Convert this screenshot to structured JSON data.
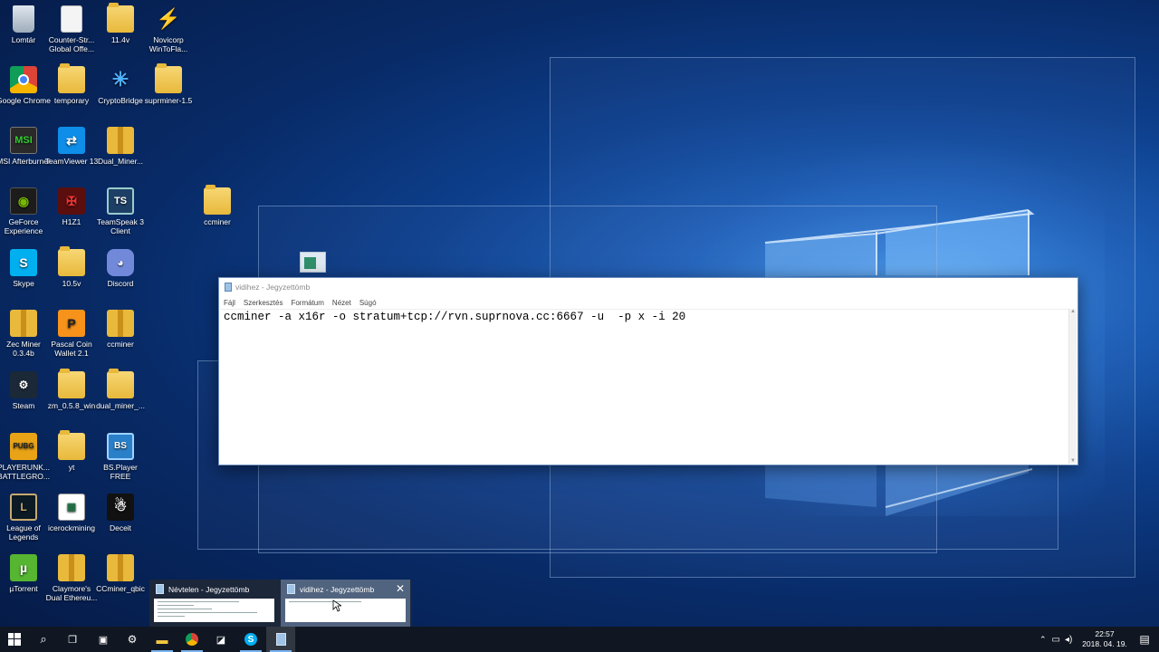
{
  "desktop": {
    "icons": [
      {
        "label": "Lomtár",
        "icon": "recycle-bin-icon"
      },
      {
        "label": "Counter-Str... Global Offe...",
        "icon": "document-icon"
      },
      {
        "label": "11.4v",
        "icon": "folder-icon"
      },
      {
        "label": "Novicorp WinToFla...",
        "icon": "wizard-icon"
      },
      {
        "label": "Google Chrome",
        "icon": "chrome-icon"
      },
      {
        "label": "temporary",
        "icon": "folder-icon"
      },
      {
        "label": "CryptoBridge",
        "icon": "cryptobridge-icon"
      },
      {
        "label": "suprminer-1.5",
        "icon": "folder-icon"
      },
      {
        "label": "MSI Afterburner",
        "icon": "msi-afterburner-icon"
      },
      {
        "label": "TeamViewer 13",
        "icon": "teamviewer-icon"
      },
      {
        "label": "Dual_Miner...",
        "icon": "zip-folder-icon"
      },
      {
        "label": "GeForce Experience",
        "icon": "geforce-icon"
      },
      {
        "label": "H1Z1",
        "icon": "h1z1-icon"
      },
      {
        "label": "TeamSpeak 3 Client",
        "icon": "teamspeak-icon"
      },
      {
        "label": "ccminer",
        "icon": "folder-icon"
      },
      {
        "label": "Skype",
        "icon": "skype-icon"
      },
      {
        "label": "10.5v",
        "icon": "folder-icon"
      },
      {
        "label": "Discord",
        "icon": "discord-icon"
      },
      {
        "label": "Zec Miner 0.3.4b",
        "icon": "zip-folder-icon"
      },
      {
        "label": "Pascal Coin Wallet 2.1",
        "icon": "pascalcoin-icon"
      },
      {
        "label": "ccminer",
        "icon": "zip-folder-icon"
      },
      {
        "label": "Steam",
        "icon": "steam-icon"
      },
      {
        "label": "zm_0.5.8_win",
        "icon": "folder-icon"
      },
      {
        "label": "dual_miner_...",
        "icon": "folder-icon"
      },
      {
        "label": "PLAYERUNK... BATTLEGRO...",
        "icon": "pubg-icon"
      },
      {
        "label": "yt",
        "icon": "folder-icon"
      },
      {
        "label": "BS.Player FREE",
        "icon": "bsplayer-icon"
      },
      {
        "label": "League of Legends",
        "icon": "league-icon"
      },
      {
        "label": "icerockmining",
        "icon": "spreadsheet-icon"
      },
      {
        "label": "Deceit",
        "icon": "deceit-icon"
      },
      {
        "label": "µTorrent",
        "icon": "utorrent-icon"
      },
      {
        "label": "Claymore's Dual Ethereu...",
        "icon": "zip-folder-icon"
      },
      {
        "label": "CCminer_qbic",
        "icon": "zip-folder-icon"
      }
    ]
  },
  "notepad": {
    "title": "vidihez - Jegyzettömb",
    "menu": [
      "Fájl",
      "Szerkesztés",
      "Formátum",
      "Nézet",
      "Súgó"
    ],
    "content": "ccminer -a x16r -o stratum+tcp://rvn.suprnova.cc:6667 -u  -p x -i 20"
  },
  "taskbar_preview": {
    "items": [
      {
        "title": "Névtelen - Jegyzettömb"
      },
      {
        "title": "vidihez - Jegyzettömb"
      }
    ]
  },
  "taskbar": {
    "pinned": [
      "start-icon",
      "search-icon",
      "task-view-icon",
      "app-icon",
      "steam-icon",
      "file-explorer-icon",
      "chrome-icon",
      "app-icon",
      "skype-icon",
      "notepad-icon"
    ],
    "clock_time": "22:57",
    "clock_date": "2018. 04. 19."
  }
}
